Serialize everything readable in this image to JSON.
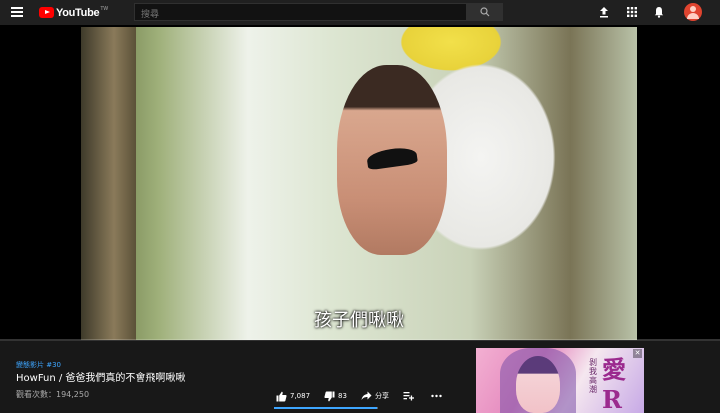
{
  "header": {
    "logo_text": "YouTube",
    "logo_region": "TW",
    "search_placeholder": "搜尋",
    "icons": [
      "menu-icon",
      "search-icon",
      "upload-icon",
      "apps-icon",
      "notifications-icon",
      "account-icon"
    ]
  },
  "player": {
    "subtitle": "孩子們啾啾",
    "progress": 0.0
  },
  "video": {
    "hashtag": "變態影片 #30",
    "title": "HowFun / 爸爸我們真的不會飛啊啾啾",
    "views": "觀看次數：194,250",
    "likes": "7,087",
    "dislikes": "83",
    "share_label": "分享",
    "like_ratio": 0.988
  },
  "ad": {
    "title": "愛R",
    "vertical_text": "剝我高潮"
  },
  "colors": {
    "brand_red": "#ff0000",
    "accent_blue": "#3ea6ff",
    "bg_dark": "#181818"
  }
}
